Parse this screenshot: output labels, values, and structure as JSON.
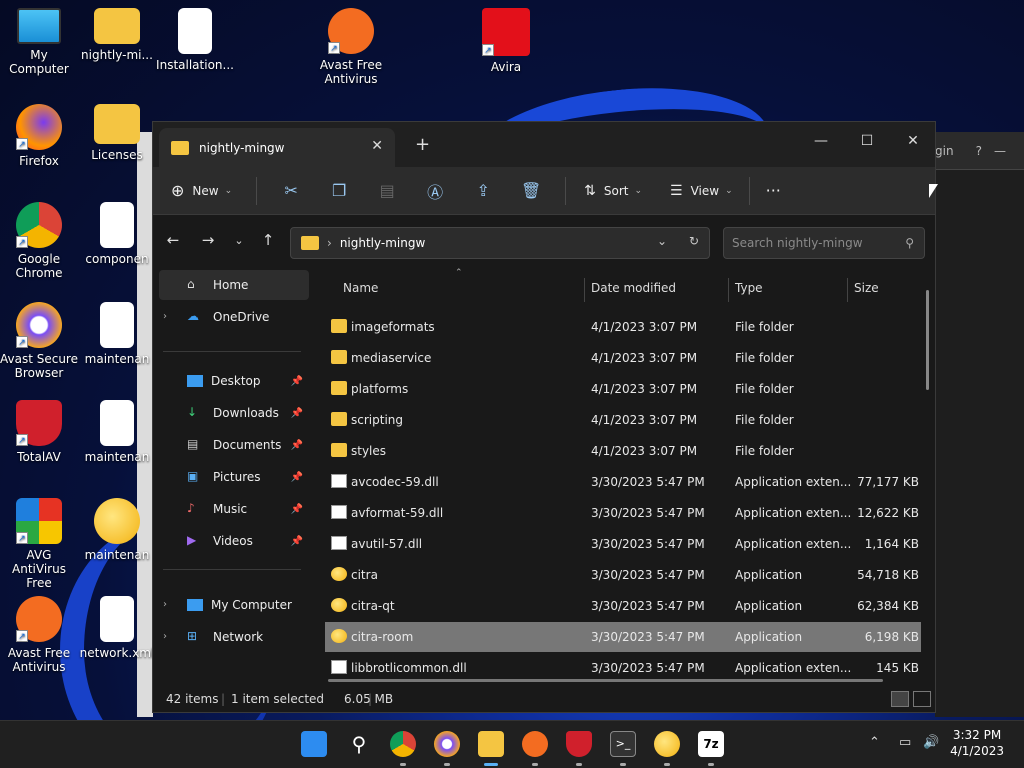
{
  "desktop": {
    "icons": [
      {
        "label": "My Computer"
      },
      {
        "label": "nightly-mi..."
      },
      {
        "label": "Installation..."
      },
      {
        "label": "Avast Free Antivirus"
      },
      {
        "label": "Avira"
      },
      {
        "label": "Firefox"
      },
      {
        "label": "Licenses"
      },
      {
        "label": "Google Chrome"
      },
      {
        "label": "componen"
      },
      {
        "label": "Avast Secure Browser"
      },
      {
        "label": "maintenan"
      },
      {
        "label": "TotalAV"
      },
      {
        "label": "maintenan"
      },
      {
        "label": "AVG AntiVirus Free"
      },
      {
        "label": "maintenan"
      },
      {
        "label": "Avast Free Antivirus"
      },
      {
        "label": "network.xml"
      }
    ],
    "background_window_hint": "gin"
  },
  "explorer": {
    "tab_title": "nightly-mingw",
    "toolbar": {
      "new_label": "New",
      "sort_label": "Sort",
      "view_label": "View",
      "more_label": "···"
    },
    "address": {
      "path": "nightly-mingw",
      "search_placeholder": "Search nightly-mingw"
    },
    "sidebar": {
      "home": "Home",
      "onedrive": "OneDrive",
      "desktop": "Desktop",
      "downloads": "Downloads",
      "documents": "Documents",
      "pictures": "Pictures",
      "music": "Music",
      "videos": "Videos",
      "mycomputer": "My Computer",
      "network": "Network"
    },
    "columns": {
      "name": "Name",
      "date": "Date modified",
      "type": "Type",
      "size": "Size"
    },
    "files": [
      {
        "name": "imageformats",
        "date": "4/1/2023 3:07 PM",
        "type": "File folder",
        "size": "",
        "kind": "folder"
      },
      {
        "name": "mediaservice",
        "date": "4/1/2023 3:07 PM",
        "type": "File folder",
        "size": "",
        "kind": "folder"
      },
      {
        "name": "platforms",
        "date": "4/1/2023 3:07 PM",
        "type": "File folder",
        "size": "",
        "kind": "folder"
      },
      {
        "name": "scripting",
        "date": "4/1/2023 3:07 PM",
        "type": "File folder",
        "size": "",
        "kind": "folder"
      },
      {
        "name": "styles",
        "date": "4/1/2023 3:07 PM",
        "type": "File folder",
        "size": "",
        "kind": "folder"
      },
      {
        "name": "avcodec-59.dll",
        "date": "3/30/2023 5:47 PM",
        "type": "Application exten...",
        "size": "77,177 KB",
        "kind": "dll"
      },
      {
        "name": "avformat-59.dll",
        "date": "3/30/2023 5:47 PM",
        "type": "Application exten...",
        "size": "12,622 KB",
        "kind": "dll"
      },
      {
        "name": "avutil-57.dll",
        "date": "3/30/2023 5:47 PM",
        "type": "Application exten...",
        "size": "1,164 KB",
        "kind": "dll"
      },
      {
        "name": "citra",
        "date": "3/30/2023 5:47 PM",
        "type": "Application",
        "size": "54,718 KB",
        "kind": "app"
      },
      {
        "name": "citra-qt",
        "date": "3/30/2023 5:47 PM",
        "type": "Application",
        "size": "62,384 KB",
        "kind": "app"
      },
      {
        "name": "citra-room",
        "date": "3/30/2023 5:47 PM",
        "type": "Application",
        "size": "6,198 KB",
        "kind": "app",
        "selected": true
      },
      {
        "name": "libbrotlicommon.dll",
        "date": "3/30/2023 5:47 PM",
        "type": "Application exten...",
        "size": "145 KB",
        "kind": "dll"
      }
    ],
    "status": {
      "items": "42 items",
      "selected": "1 item selected",
      "selected_size": "6.05 MB"
    }
  },
  "taskbar": {
    "clock_time": "3:32 PM",
    "clock_date": "4/1/2023"
  },
  "colors": {
    "folder": "#f4c542",
    "selection": "#777777",
    "taskbar": "#202020",
    "explorer_bg": "#191919"
  }
}
